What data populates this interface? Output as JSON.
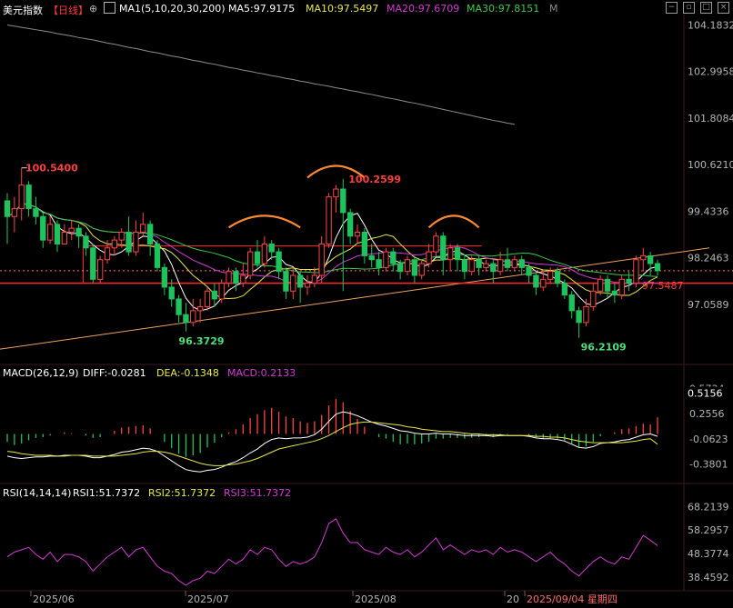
{
  "header": {
    "title": "美元指数",
    "period": "【日线】",
    "ma_label": "MA1(5,10,20,30,200)",
    "ma5": "MA5:97.9175",
    "ma10": "MA10:97.5497",
    "ma20": "MA20:97.6709",
    "ma30": "MA30:97.8151",
    "more": "M"
  },
  "colors": {
    "up": "#ff4545",
    "down": "#1fc35e",
    "ma5": "#ffffff",
    "ma10": "#e8e84a",
    "ma20": "#d23bd2",
    "ma30": "#3cc94a",
    "ma200": "#8c8c8c",
    "trend": "#f0a060",
    "arc": "#ff8a30",
    "hline": "#ff2a2a",
    "axis_text": "#b4b4b4"
  },
  "chart_data": [
    {
      "type": "candlestick",
      "price_axis_ticks": [
        "104.1832",
        "102.9958",
        "101.8084",
        "100.6210",
        "99.4336",
        "98.2463",
        "97.0589"
      ],
      "current_price_label": "97.5487",
      "annotations": {
        "high_left": "100.5400",
        "high_mid": "100.2599",
        "low_left": "96.3729",
        "low_right": "96.2109"
      },
      "x_labels": [
        "2025/06",
        "2025/07",
        "2025/08",
        "20",
        "2025/09/04 星期四"
      ],
      "ylim": [
        95.6,
        104.4
      ],
      "candles": [
        [
          99.7,
          99.3,
          99.9,
          98.6
        ],
        [
          99.3,
          99.5,
          99.8,
          98.9
        ],
        [
          99.5,
          100.1,
          100.54,
          99.2
        ],
        [
          100.1,
          99.5,
          100.2,
          99.3
        ],
        [
          99.5,
          99.3,
          99.8,
          99.1
        ],
        [
          99.3,
          98.7,
          99.4,
          98.5
        ],
        [
          98.7,
          99.1,
          99.3,
          98.6
        ],
        [
          99.1,
          98.6,
          99.2,
          98.4
        ],
        [
          98.6,
          98.9,
          99.1,
          98.6
        ],
        [
          98.9,
          99.0,
          99.2,
          98.7
        ],
        [
          99.0,
          98.8,
          99.1,
          98.5
        ],
        [
          98.8,
          98.5,
          98.9,
          98.3
        ],
        [
          98.5,
          97.7,
          98.6,
          97.6
        ],
        [
          97.7,
          98.2,
          98.3,
          97.6
        ],
        [
          98.2,
          98.5,
          98.7,
          98.1
        ],
        [
          98.5,
          98.7,
          98.8,
          98.3
        ],
        [
          98.7,
          98.9,
          99.0,
          98.5
        ],
        [
          98.9,
          98.4,
          99.3,
          98.3
        ],
        [
          98.4,
          98.9,
          99.2,
          98.3
        ],
        [
          98.9,
          99.1,
          99.4,
          98.8
        ],
        [
          99.1,
          98.6,
          99.2,
          98.3
        ],
        [
          98.6,
          98.0,
          98.7,
          97.9
        ],
        [
          98.0,
          97.5,
          98.1,
          97.3
        ],
        [
          97.5,
          97.2,
          97.7,
          97.0
        ],
        [
          97.2,
          96.8,
          97.3,
          96.6
        ],
        [
          96.8,
          96.6,
          97.1,
          96.37
        ],
        [
          96.6,
          96.9,
          97.2,
          96.5
        ],
        [
          96.9,
          97.0,
          97.2,
          96.6
        ],
        [
          97.0,
          97.4,
          97.5,
          96.9
        ],
        [
          97.4,
          97.2,
          97.6,
          97.0
        ],
        [
          97.2,
          97.6,
          97.7,
          97.1
        ],
        [
          97.6,
          97.9,
          98.0,
          97.5
        ],
        [
          97.9,
          97.6,
          98.0,
          97.4
        ],
        [
          97.6,
          97.8,
          98.1,
          97.5
        ],
        [
          97.8,
          98.4,
          98.5,
          97.7
        ],
        [
          98.4,
          98.1,
          98.7,
          98.0
        ],
        [
          98.1,
          98.6,
          98.8,
          98.0
        ],
        [
          98.6,
          98.4,
          98.7,
          98.2
        ],
        [
          98.4,
          97.9,
          98.5,
          97.7
        ],
        [
          97.9,
          97.4,
          98.0,
          97.2
        ],
        [
          97.4,
          97.8,
          98.0,
          97.2
        ],
        [
          97.8,
          97.5,
          97.9,
          97.1
        ],
        [
          97.5,
          97.6,
          97.8,
          97.3
        ],
        [
          97.6,
          97.8,
          98.0,
          97.5
        ],
        [
          97.8,
          98.6,
          98.8,
          97.6
        ],
        [
          98.6,
          99.8,
          99.9,
          98.5
        ],
        [
          99.8,
          100.0,
          100.1,
          99.4
        ],
        [
          100.0,
          99.4,
          100.26,
          97.4
        ],
        [
          99.4,
          98.8,
          99.5,
          98.6
        ],
        [
          98.8,
          98.9,
          99.1,
          98.6
        ],
        [
          98.9,
          98.3,
          99.0,
          98.1
        ],
        [
          98.3,
          98.2,
          98.6,
          98.0
        ],
        [
          98.2,
          98.0,
          98.4,
          97.8
        ],
        [
          98.0,
          98.4,
          98.5,
          97.9
        ],
        [
          98.4,
          98.1,
          98.5,
          97.9
        ],
        [
          98.1,
          97.9,
          98.2,
          97.7
        ],
        [
          97.9,
          98.2,
          98.3,
          97.8
        ],
        [
          98.2,
          97.8,
          98.3,
          97.6
        ],
        [
          97.8,
          98.1,
          98.2,
          97.7
        ],
        [
          98.1,
          98.4,
          98.6,
          98.0
        ],
        [
          98.4,
          98.8,
          98.9,
          98.3
        ],
        [
          98.8,
          98.2,
          98.9,
          97.8
        ],
        [
          98.2,
          98.5,
          98.6,
          97.9
        ],
        [
          98.5,
          98.2,
          98.6,
          97.9
        ],
        [
          98.2,
          97.9,
          98.3,
          97.7
        ],
        [
          97.9,
          98.2,
          98.3,
          97.8
        ],
        [
          98.2,
          98.0,
          98.3,
          97.8
        ],
        [
          98.0,
          98.1,
          98.2,
          97.9
        ],
        [
          98.1,
          97.9,
          98.2,
          97.6
        ],
        [
          97.9,
          98.2,
          98.4,
          97.8
        ],
        [
          98.2,
          98.0,
          98.5,
          97.9
        ],
        [
          98.0,
          98.2,
          98.3,
          97.9
        ],
        [
          98.2,
          98.0,
          98.3,
          97.8
        ],
        [
          98.0,
          97.8,
          98.1,
          97.6
        ],
        [
          97.8,
          97.5,
          97.9,
          97.3
        ],
        [
          97.5,
          97.7,
          97.9,
          97.4
        ],
        [
          97.7,
          97.9,
          98.0,
          97.6
        ],
        [
          97.9,
          97.6,
          98.0,
          97.5
        ],
        [
          97.6,
          97.3,
          97.7,
          97.2
        ],
        [
          97.3,
          96.9,
          97.4,
          96.7
        ],
        [
          96.9,
          96.6,
          97.0,
          96.21
        ],
        [
          96.6,
          97.0,
          97.2,
          96.5
        ],
        [
          97.0,
          97.4,
          97.6,
          96.9
        ],
        [
          97.4,
          97.7,
          97.8,
          97.3
        ],
        [
          97.7,
          97.4,
          97.8,
          97.2
        ],
        [
          97.4,
          97.3,
          97.6,
          97.1
        ],
        [
          97.3,
          97.7,
          97.8,
          97.2
        ],
        [
          97.7,
          97.6,
          97.9,
          97.4
        ],
        [
          97.6,
          98.2,
          98.3,
          97.5
        ],
        [
          98.2,
          98.3,
          98.5,
          97.9
        ],
        [
          98.3,
          98.1,
          98.4,
          97.8
        ],
        [
          98.1,
          97.92,
          98.2,
          97.8
        ]
      ],
      "ma200": [
        104.18,
        104.15,
        104.12,
        104.09,
        104.06,
        104.03,
        104.0,
        103.96,
        103.93,
        103.9,
        103.86,
        103.83,
        103.8,
        103.76,
        103.72,
        103.69,
        103.65,
        103.61,
        103.58,
        103.54,
        103.5,
        103.47,
        103.43,
        103.39,
        103.36,
        103.32,
        103.28,
        103.25,
        103.21,
        103.18,
        103.14,
        103.1,
        103.07,
        103.03,
        103.0,
        102.96,
        102.93,
        102.89,
        102.86,
        102.82,
        102.79,
        102.75,
        102.72,
        102.68,
        102.65,
        102.62,
        102.58,
        102.55,
        102.51,
        102.48,
        102.44,
        102.41,
        102.37,
        102.33,
        102.3,
        102.26,
        102.22,
        102.19,
        102.15,
        102.11,
        102.07,
        102.03,
        101.99,
        101.95,
        101.91,
        101.87,
        101.83,
        101.79,
        101.75,
        101.72,
        101.68,
        101.65
      ]
    },
    {
      "type": "bar",
      "title": "MACD(26,12,9)",
      "diff_label": "DIFF:-0.0281",
      "dea_label": "DEA:-0.1348",
      "macd_label": "MACD:0.2133",
      "axis_ticks": [
        "0.5734",
        "0.2556",
        "-0.0623",
        "-0.3801"
      ],
      "current_label": "0.5156",
      "ylim": [
        -0.58,
        0.66
      ],
      "diff": [
        -0.28,
        -0.3,
        -0.31,
        -0.3,
        -0.29,
        -0.29,
        -0.28,
        -0.28,
        -0.27,
        -0.27,
        -0.27,
        -0.28,
        -0.3,
        -0.3,
        -0.28,
        -0.26,
        -0.23,
        -0.22,
        -0.2,
        -0.18,
        -0.19,
        -0.22,
        -0.28,
        -0.34,
        -0.4,
        -0.45,
        -0.47,
        -0.48,
        -0.46,
        -0.45,
        -0.42,
        -0.38,
        -0.35,
        -0.3,
        -0.24,
        -0.19,
        -0.12,
        -0.07,
        -0.05,
        -0.06,
        -0.05,
        -0.05,
        -0.04,
        -0.01,
        0.06,
        0.16,
        0.25,
        0.28,
        0.26,
        0.23,
        0.19,
        0.15,
        0.12,
        0.1,
        0.07,
        0.04,
        0.03,
        0.01,
        0.0,
        0.0,
        0.01,
        0.0,
        0.0,
        -0.01,
        -0.02,
        -0.02,
        -0.02,
        -0.02,
        -0.03,
        -0.02,
        -0.02,
        -0.02,
        -0.02,
        -0.03,
        -0.05,
        -0.06,
        -0.06,
        -0.07,
        -0.09,
        -0.13,
        -0.17,
        -0.18,
        -0.16,
        -0.12,
        -0.11,
        -0.1,
        -0.08,
        -0.07,
        -0.04,
        -0.01,
        0.0,
        -0.03
      ],
      "dea": [
        -0.22,
        -0.23,
        -0.25,
        -0.26,
        -0.27,
        -0.27,
        -0.27,
        -0.28,
        -0.28,
        -0.27,
        -0.27,
        -0.27,
        -0.28,
        -0.28,
        -0.28,
        -0.28,
        -0.27,
        -0.26,
        -0.25,
        -0.23,
        -0.22,
        -0.22,
        -0.23,
        -0.25,
        -0.28,
        -0.31,
        -0.34,
        -0.37,
        -0.39,
        -0.4,
        -0.4,
        -0.39,
        -0.38,
        -0.36,
        -0.34,
        -0.31,
        -0.27,
        -0.23,
        -0.19,
        -0.17,
        -0.15,
        -0.13,
        -0.11,
        -0.09,
        -0.06,
        -0.02,
        0.03,
        0.08,
        0.12,
        0.14,
        0.15,
        0.15,
        0.14,
        0.13,
        0.12,
        0.11,
        0.09,
        0.08,
        0.06,
        0.05,
        0.04,
        0.03,
        0.03,
        0.02,
        0.01,
        0.0,
        0.0,
        -0.01,
        -0.01,
        -0.01,
        -0.02,
        -0.02,
        -0.02,
        -0.02,
        -0.03,
        -0.03,
        -0.04,
        -0.04,
        -0.05,
        -0.07,
        -0.09,
        -0.1,
        -0.11,
        -0.11,
        -0.11,
        -0.11,
        -0.11,
        -0.1,
        -0.09,
        -0.07,
        -0.06,
        -0.13
      ],
      "macd": [
        -0.1,
        -0.14,
        -0.12,
        -0.08,
        -0.05,
        -0.04,
        -0.02,
        0.0,
        0.02,
        0.01,
        0.0,
        -0.02,
        -0.05,
        -0.04,
        0.0,
        0.04,
        0.08,
        0.09,
        0.1,
        0.11,
        0.07,
        0.0,
        -0.1,
        -0.18,
        -0.25,
        -0.29,
        -0.27,
        -0.24,
        -0.17,
        -0.11,
        -0.04,
        0.02,
        0.06,
        0.12,
        0.2,
        0.25,
        0.3,
        0.33,
        0.28,
        0.22,
        0.2,
        0.16,
        0.14,
        0.16,
        0.24,
        0.36,
        0.44,
        0.4,
        0.29,
        0.19,
        0.09,
        0.0,
        -0.04,
        -0.06,
        -0.1,
        -0.13,
        -0.12,
        -0.13,
        -0.12,
        -0.1,
        -0.06,
        -0.06,
        -0.05,
        -0.05,
        -0.06,
        -0.05,
        -0.04,
        -0.03,
        -0.04,
        -0.02,
        -0.01,
        0.0,
        0.0,
        -0.02,
        -0.04,
        -0.06,
        -0.05,
        -0.06,
        -0.08,
        -0.12,
        -0.16,
        -0.16,
        -0.1,
        -0.03,
        0.0,
        0.02,
        0.06,
        0.07,
        0.1,
        0.13,
        0.12,
        0.21
      ]
    },
    {
      "type": "line",
      "title": "RSI(14,14,14)",
      "rsi1_label": "RSI1:51.7372",
      "rsi2_label": "RSI2:51.7372",
      "rsi3_label": "RSI3:51.7372",
      "axis_ticks": [
        "68.2139",
        "58.2957",
        "48.3774",
        "38.4592"
      ],
      "ylim": [
        33.5,
        71
      ],
      "values": [
        47,
        49,
        50,
        51,
        48,
        46,
        49,
        45,
        48,
        48,
        47,
        45,
        41,
        44,
        47,
        49,
        51,
        47,
        50,
        51,
        47,
        43,
        41,
        40,
        37,
        35,
        37,
        38,
        41,
        40,
        43,
        46,
        44,
        46,
        50,
        48,
        51,
        50,
        46,
        43,
        45,
        44,
        45,
        47,
        53,
        61,
        63,
        57,
        53,
        53,
        50,
        49,
        48,
        51,
        49,
        48,
        50,
        47,
        49,
        52,
        55,
        50,
        52,
        50,
        48,
        50,
        49,
        50,
        48,
        51,
        49,
        50,
        49,
        47,
        45,
        47,
        49,
        46,
        44,
        41,
        39,
        42,
        45,
        47,
        45,
        44,
        47,
        46,
        51,
        56,
        54,
        51.74
      ]
    }
  ]
}
